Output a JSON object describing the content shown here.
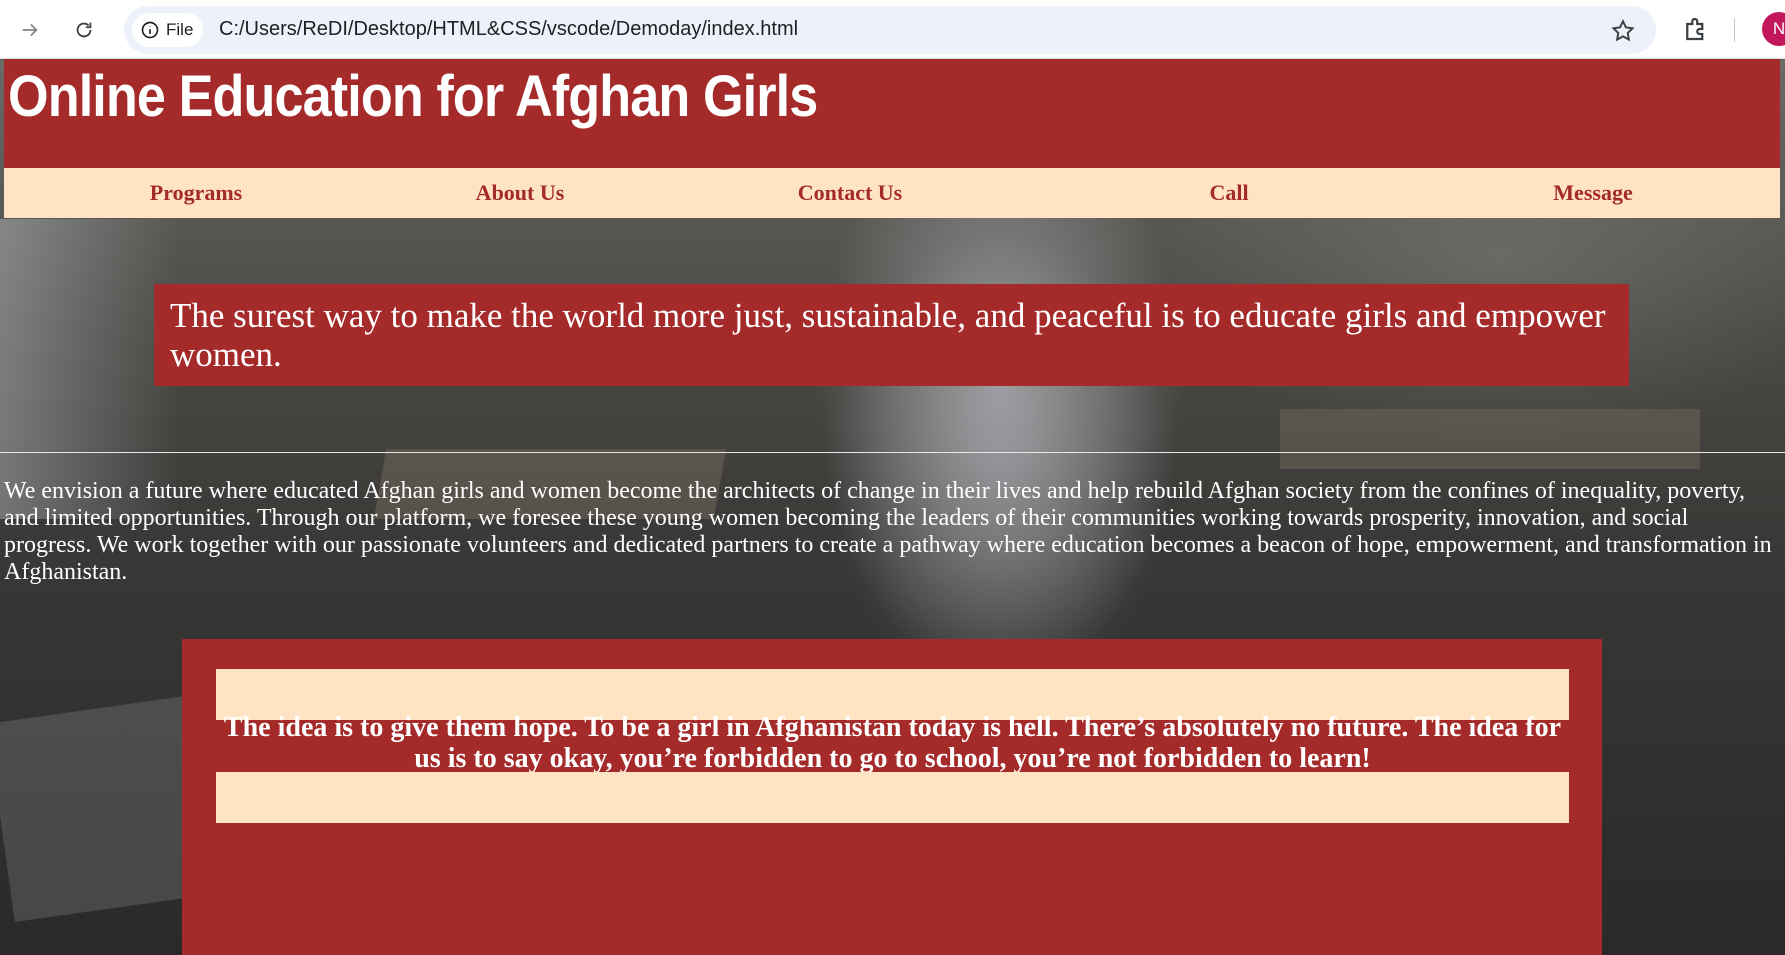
{
  "browser": {
    "site_info_label": "File",
    "url": "C:/Users/ReDI/Desktop/HTML&CSS/vscode/Demoday/index.html",
    "profile_initial": "N",
    "icons": [
      "forward-arrow-icon",
      "reload-icon",
      "info-icon",
      "star-icon",
      "extensions-icon"
    ]
  },
  "header": {
    "title": "Online Education for Afghan Girls"
  },
  "nav": {
    "items": [
      {
        "label": "Programs"
      },
      {
        "label": "About Us"
      },
      {
        "label": "Contact Us"
      },
      {
        "label": "Call"
      },
      {
        "label": "Message"
      }
    ]
  },
  "hero": {
    "quote": "The surest way to make the world more just, sustainable, and peaceful is to educate girls and empower women."
  },
  "vision": {
    "text": "We envision a future where educated Afghan girls and women become the architects of change in their lives and help rebuild Afghan society from the confines of inequality, poverty, and limited opportunities. Through our platform, we foresee these young women becoming the leaders of their communities working towards prosperity, innovation, and social progress. We work together with our passionate volunteers and dedicated partners to create a pathway where education becomes a beacon of hope, empowerment, and transformation in Afghanistan."
  },
  "hope": {
    "text": "The idea is to give them hope. To be a girl in Afghanistan today is hell. There’s absolutely no future. The idea for us is to say okay, you’re forbidden to go to school, you’re not forbidden to learn!"
  },
  "colors": {
    "brand_red": "#a52a2a",
    "bisque": "#ffe4c4",
    "white": "#ffffff"
  }
}
